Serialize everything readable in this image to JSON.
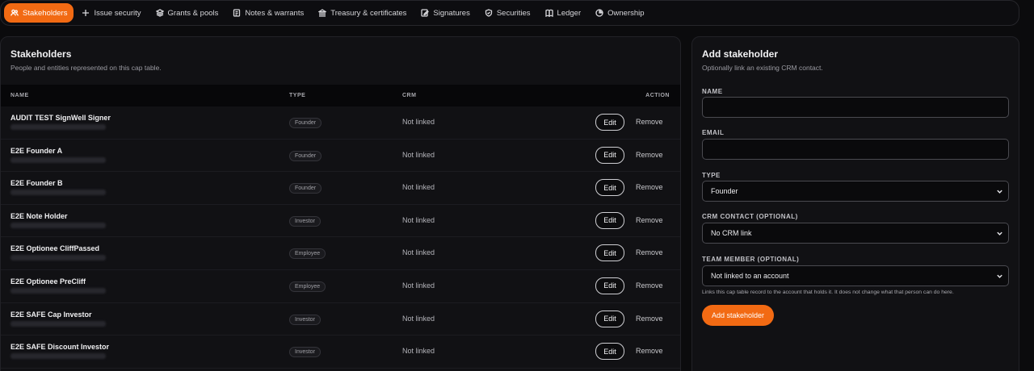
{
  "nav": [
    {
      "label": "Stakeholders",
      "icon": "users-icon",
      "active": true
    },
    {
      "label": "Issue security",
      "icon": "plus-icon"
    },
    {
      "label": "Grants & pools",
      "icon": "layers-icon"
    },
    {
      "label": "Notes & warrants",
      "icon": "note-icon"
    },
    {
      "label": "Treasury & certificates",
      "icon": "bank-icon"
    },
    {
      "label": "Signatures",
      "icon": "signature-icon"
    },
    {
      "label": "Securities",
      "icon": "shield-icon"
    },
    {
      "label": "Ledger",
      "icon": "book-icon"
    },
    {
      "label": "Ownership",
      "icon": "pie-icon"
    }
  ],
  "stakeholders": {
    "title": "Stakeholders",
    "subtitle": "People and entities represented on this cap table.",
    "columns": {
      "name": "NAME",
      "type": "TYPE",
      "crm": "CRM",
      "action": "ACTION"
    },
    "edit_label": "Edit",
    "remove_label": "Remove",
    "rows": [
      {
        "name": "AUDIT TEST SignWell Signer",
        "type": "Founder",
        "crm": "Not linked"
      },
      {
        "name": "E2E Founder A",
        "type": "Founder",
        "crm": "Not linked"
      },
      {
        "name": "E2E Founder B",
        "type": "Founder",
        "crm": "Not linked"
      },
      {
        "name": "E2E Note Holder",
        "type": "Investor",
        "crm": "Not linked"
      },
      {
        "name": "E2E Optionee CliffPassed",
        "type": "Employee",
        "crm": "Not linked"
      },
      {
        "name": "E2E Optionee PreCliff",
        "type": "Employee",
        "crm": "Not linked"
      },
      {
        "name": "E2E SAFE Cap Investor",
        "type": "Investor",
        "crm": "Not linked"
      },
      {
        "name": "E2E SAFE Discount Investor",
        "type": "Investor",
        "crm": "Not linked"
      }
    ]
  },
  "form": {
    "title": "Add stakeholder",
    "subtitle": "Optionally link an existing CRM contact.",
    "name_label": "NAME",
    "name_value": "",
    "email_label": "EMAIL",
    "email_value": "",
    "type_label": "TYPE",
    "type_value": "Founder",
    "crm_label": "CRM CONTACT (OPTIONAL)",
    "crm_value": "No CRM link",
    "team_label": "TEAM MEMBER (OPTIONAL)",
    "team_value": "Not linked to an account",
    "helper": "Links this cap table record to the account that holds it. It does not change what that person can do here.",
    "submit_label": "Add stakeholder"
  },
  "colors": {
    "accent": "#f26a13",
    "background": "#0b0b0d",
    "panel": "#111114"
  }
}
